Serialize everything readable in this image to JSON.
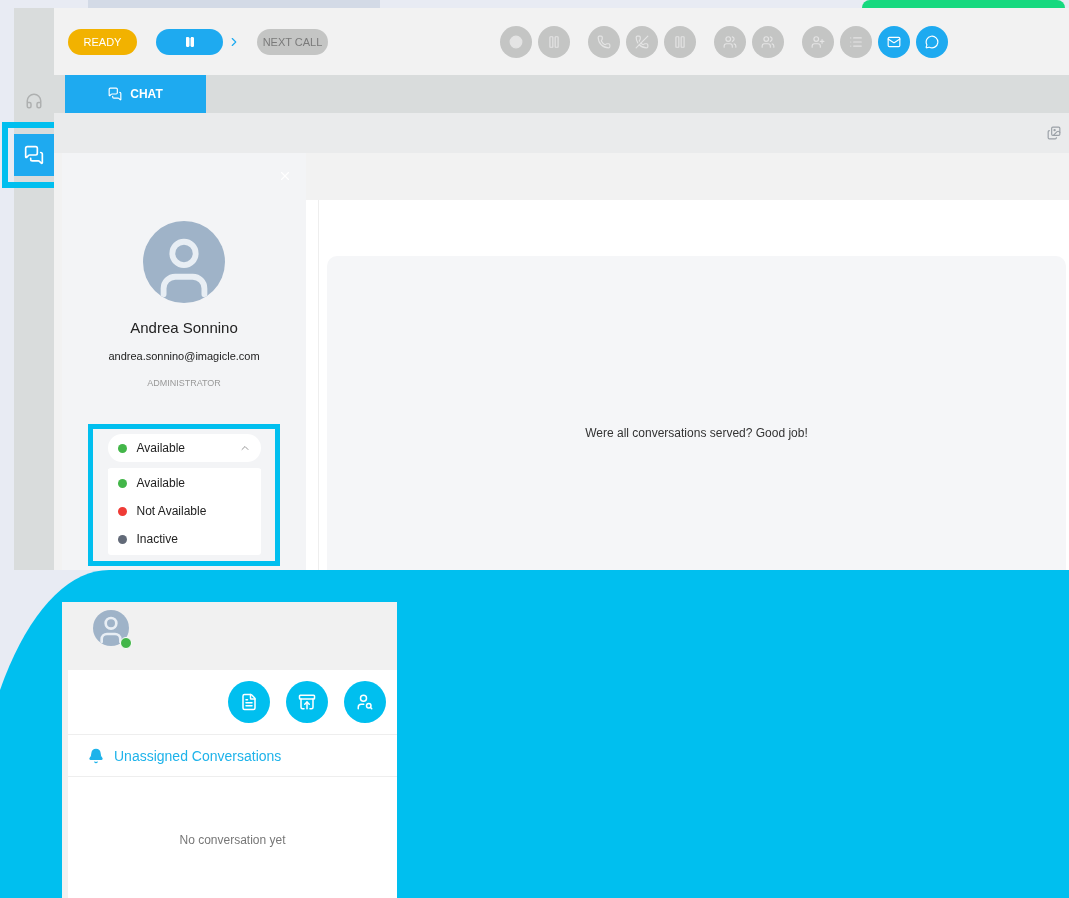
{
  "toolbar": {
    "ready_button": {
      "label": "READY",
      "selected": true
    },
    "pause_button": {
      "active": true
    },
    "next_call_button": {
      "label": "NEXT CALL",
      "disabled": true
    },
    "control_groups": [
      [
        {
          "active": false
        },
        {
          "active": false
        }
      ],
      [
        {
          "active": false
        },
        {
          "active": false
        },
        {
          "active": false
        }
      ],
      [
        {
          "active": false
        },
        {
          "active": false
        }
      ],
      [
        {
          "active": false
        },
        {
          "active": false
        },
        {
          "active": true
        },
        {
          "active": true
        }
      ]
    ]
  },
  "rail": [
    {
      "selected": false
    },
    {
      "selected": true
    }
  ],
  "tabs": [
    {
      "label": "CHAT",
      "selected": true
    }
  ],
  "profile": {
    "name": "Andrea Sonnino",
    "email": "andrea.sonnino@imagicle.com",
    "role": "ADMINISTRATOR"
  },
  "status_select": {
    "value": "Available",
    "color": "#43b649",
    "expanded": true,
    "options": [
      {
        "label": "Available",
        "color": "#43b649"
      },
      {
        "label": "Not Available",
        "color": "#ef3b36"
      },
      {
        "label": "Inactive",
        "color": "#626a78"
      }
    ]
  },
  "empty_message": "Were all conversations served? Good job!",
  "mini_widget": {
    "online": true,
    "section_title": "Unassigned Conversations",
    "empty_text": "No conversation yet"
  }
}
